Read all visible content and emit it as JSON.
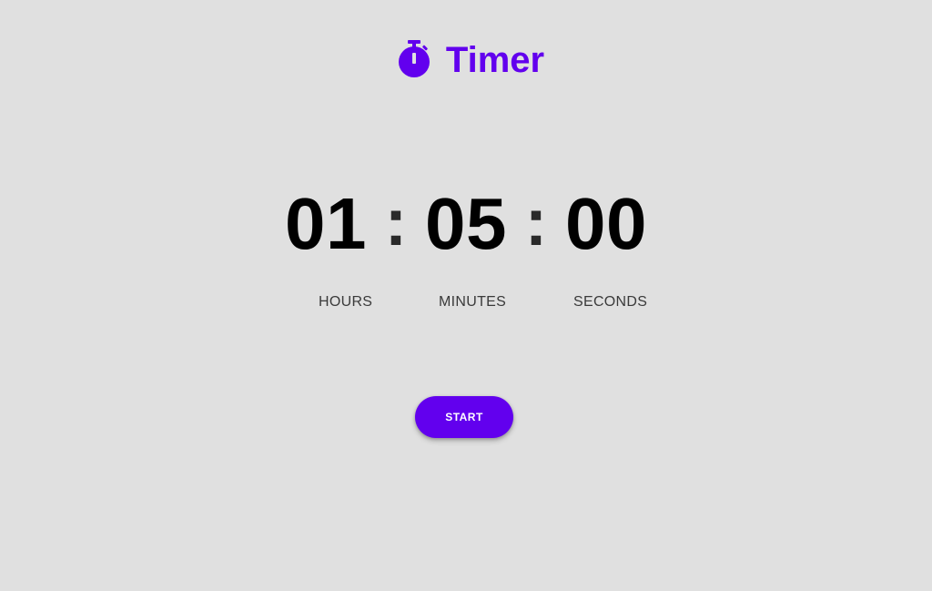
{
  "header": {
    "title": "Timer",
    "icon": "stopwatch-icon"
  },
  "timer": {
    "hours": "01",
    "minutes": "05",
    "seconds": "00",
    "separator": ":"
  },
  "labels": {
    "hours": "HOURS",
    "minutes": "MINUTES",
    "seconds": "SECONDS"
  },
  "controls": {
    "start_label": "START"
  },
  "colors": {
    "accent": "#6200ee",
    "background": "#e0e0e0",
    "digits": "#000000"
  }
}
